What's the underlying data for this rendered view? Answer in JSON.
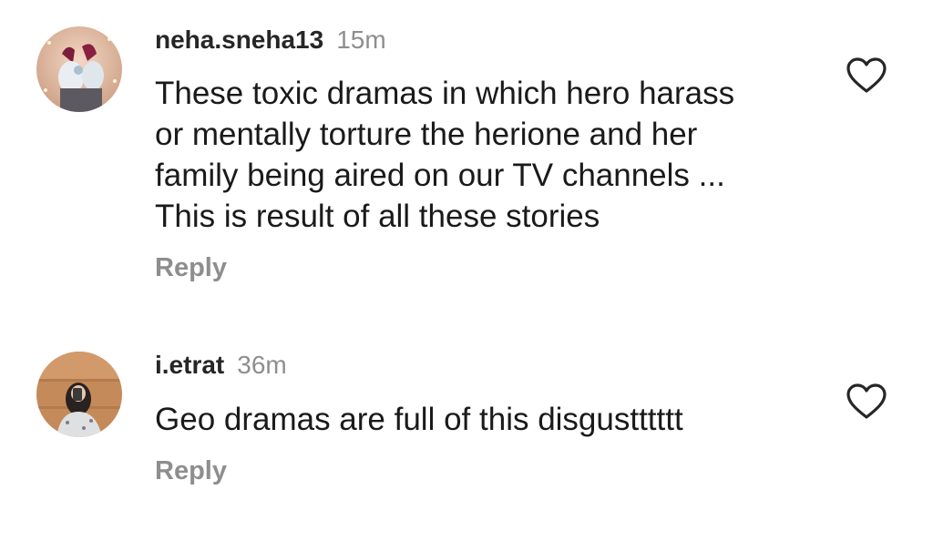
{
  "comments": [
    {
      "username": "neha.sneha13",
      "time": "15m",
      "lines": [
        "These toxic dramas in which hero harass",
        "or mentally torture the herione and her",
        "family being aired on our TV channels ...",
        "This is result of all these stories"
      ],
      "reply_label": "Reply",
      "like_icon": "heart-outline-icon"
    },
    {
      "username": "i.etrat",
      "time": "36m",
      "lines": [
        "Geo dramas are full of this disgustttttt"
      ],
      "reply_label": "Reply",
      "like_icon": "heart-outline-icon"
    }
  ],
  "colors": {
    "username": "#262626",
    "meta": "#8e8e8e",
    "text": "#1a1a1a",
    "background": "#ffffff"
  }
}
